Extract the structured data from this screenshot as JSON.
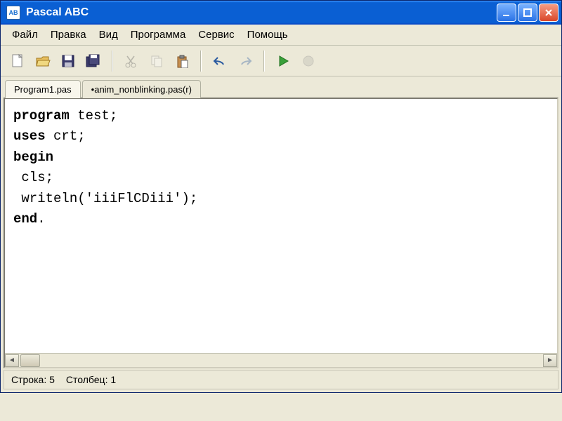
{
  "titlebar": {
    "app_icon_text": "AB",
    "title": "Pascal ABC"
  },
  "menu": {
    "file": "Файл",
    "edit": "Правка",
    "view": "Вид",
    "program": "Программа",
    "service": "Сервис",
    "help": "Помощь"
  },
  "toolbar_icons": {
    "new": "new-file-icon",
    "open": "open-icon",
    "save": "save-icon",
    "save_all": "save-all-icon",
    "cut": "cut-icon",
    "copy": "copy-icon",
    "paste": "paste-icon",
    "undo": "undo-icon",
    "redo": "redo-icon",
    "run": "run-icon",
    "stop": "stop-icon"
  },
  "tabs": [
    {
      "label": "Program1.pas",
      "active": true
    },
    {
      "label": "•anim_nonblinking.pas(r)",
      "active": false
    }
  ],
  "code": {
    "lines": [
      {
        "kw": "program",
        "rest": " test;"
      },
      {
        "kw": "uses",
        "rest": " crt;"
      },
      {
        "kw": "begin",
        "rest": ""
      },
      {
        "kw": "",
        "rest": " cls;"
      },
      {
        "kw": "",
        "rest": " writeln('iiiFlCDiii');"
      },
      {
        "kw": "end",
        "rest": "."
      }
    ]
  },
  "status": {
    "line_label": "Строка:",
    "line_value": "5",
    "col_label": "Столбец:",
    "col_value": "1"
  }
}
